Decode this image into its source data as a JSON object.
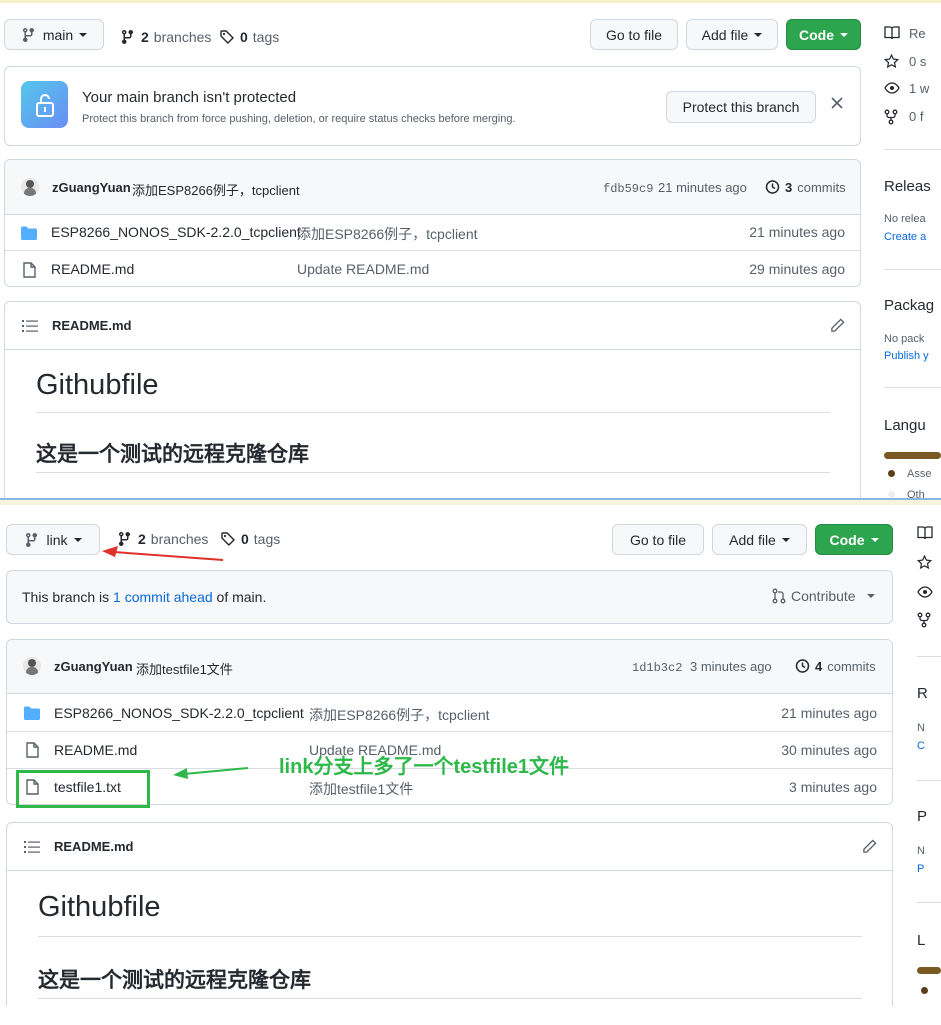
{
  "top": {
    "branch": "main",
    "branches_count": "2",
    "branches_label": "branches",
    "tags_count": "0",
    "tags_label": "tags",
    "go_to_file": "Go to file",
    "add_file": "Add file",
    "code": "Code",
    "protect_title": "Your main branch isn't protected",
    "protect_desc": "Protect this branch from force pushing, deletion, or require status checks before merging.",
    "protect_button": "Protect this branch",
    "commit_author": "zGuangYuan",
    "commit_msg": "添加ESP8266例子，tcpclient",
    "commit_sha": "fdb59c9",
    "commit_age": "21 minutes ago",
    "commits_count": "3",
    "commits_label": "commits",
    "files": [
      {
        "name": "ESP8266_NONOS_SDK-2.2.0_tcpclient",
        "msg": "添加ESP8266例子，tcpclient",
        "age": "21 minutes ago",
        "type": "dir"
      },
      {
        "name": "README.md",
        "msg": "Update README.md",
        "age": "29 minutes ago",
        "type": "file"
      }
    ],
    "readme_title": "README.md",
    "md_h1": "Githubfile",
    "md_h2": "这是一个测试的远程克隆仓库",
    "side": {
      "about_items": [
        "Re",
        "0 s",
        "1 w",
        "0 f"
      ],
      "releases": "Releas",
      "releases_none": "No relea",
      "releases_link": "Create a",
      "packages": "Packag",
      "packages_none": "No pack",
      "packages_link": "Publish y",
      "languages": "Langu",
      "lang_items": [
        "Asse",
        "Oth"
      ]
    }
  },
  "bottom": {
    "branch": "link",
    "branches_count": "2",
    "branches_label": "branches",
    "tags_count": "0",
    "tags_label": "tags",
    "go_to_file": "Go to file",
    "add_file": "Add file",
    "code": "Code",
    "ahead_prefix": "This branch is ",
    "ahead_link": "1 commit ahead",
    "ahead_suffix": " of main.",
    "contribute": "Contribute",
    "commit_author": "zGuangYuan",
    "commit_msg": "添加testfile1文件",
    "commit_sha": "1d1b3c2",
    "commit_age": "3 minutes ago",
    "commits_count": "4",
    "commits_label": "commits",
    "files": [
      {
        "name": "ESP8266_NONOS_SDK-2.2.0_tcpclient",
        "msg": "添加ESP8266例子，tcpclient",
        "age": "21 minutes ago",
        "type": "dir"
      },
      {
        "name": "README.md",
        "msg": "Update README.md",
        "age": "30 minutes ago",
        "type": "file"
      },
      {
        "name": "testfile1.txt",
        "msg": "添加testfile1文件",
        "age": "3 minutes ago",
        "type": "file"
      }
    ],
    "readme_title": "README.md",
    "md_h1": "Githubfile",
    "md_h2": "这是一个测试的远程克隆仓库",
    "side": {
      "r": "R",
      "n1": "N",
      "c1": "C",
      "p": "P",
      "n2": "N",
      "p2": "P",
      "l": "L"
    }
  },
  "annotation": "link分支上多了一个testfile1文件",
  "colors": {
    "green": "#2da44e",
    "annotation_green": "#2fb84a",
    "red_arrow": "#e0302a",
    "link": "#0969da"
  }
}
